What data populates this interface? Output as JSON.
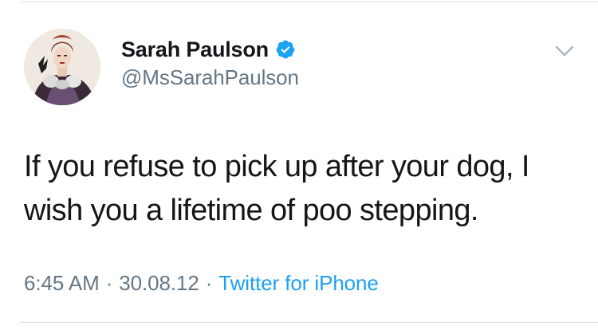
{
  "tweet": {
    "display_name": "Sarah Paulson",
    "handle": "@MsSarahPaulson",
    "text_lines": [
      "If you refuse to pick up after your dog, I",
      "wish you a lifetime of poo stepping."
    ],
    "time": "6:45 AM",
    "separator": "·",
    "date": "30.08.12",
    "source": "Twitter for iPhone"
  },
  "icons": {
    "verified": "verified-badge-icon",
    "more": "chevron-down-icon",
    "avatar": "profile-avatar"
  },
  "colors": {
    "name": "#14171a",
    "secondary": "#657786",
    "link": "#1da1f2",
    "verified": "#1da1f2",
    "divider": "#d9dee2"
  }
}
